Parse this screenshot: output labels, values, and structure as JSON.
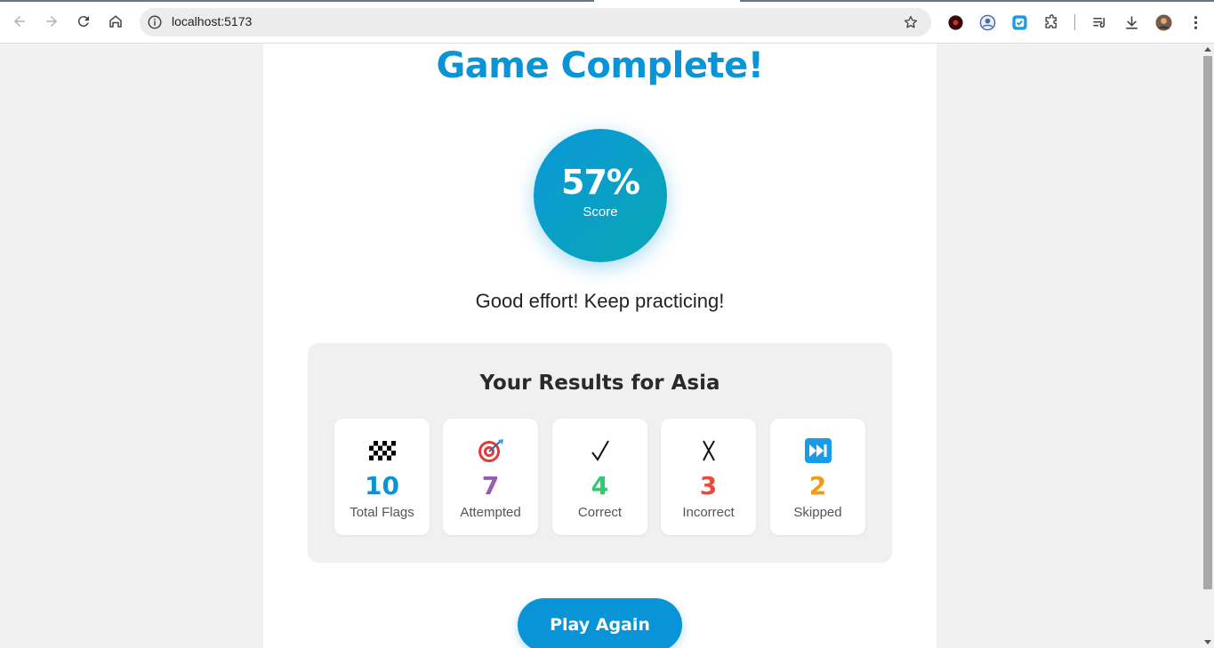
{
  "browser": {
    "url": "localhost:5173",
    "icons": [
      "back-icon",
      "forward-icon",
      "reload-icon",
      "home-icon",
      "site-info-icon",
      "bookmark-star-icon",
      "extension-record-icon",
      "extension-profile-icon",
      "extension-check-icon",
      "extensions-puzzle-icon",
      "reading-list-icon",
      "download-icon",
      "avatar",
      "menu-kebab-icon"
    ]
  },
  "game": {
    "title": "Game Complete!",
    "score": {
      "value": "57%",
      "label": "Score",
      "percent": 57
    },
    "message": "Good effort! Keep practicing!",
    "results_title": "Your Results for Asia",
    "stats": [
      {
        "icon": "checkered-flag-icon",
        "value": "10",
        "label": "Total Flags",
        "color": "#0a94d8"
      },
      {
        "icon": "target-icon",
        "value": "7",
        "label": "Attempted",
        "color": "#9b59b6"
      },
      {
        "icon": "checkmark-icon",
        "value": "4",
        "label": "Correct",
        "color": "#2ecc71"
      },
      {
        "icon": "cross-icon",
        "value": "3",
        "label": "Incorrect",
        "color": "#e74c3c"
      },
      {
        "icon": "fast-forward-icon",
        "value": "2",
        "label": "Skipped",
        "color": "#f39c12"
      }
    ],
    "play_again": "Play Again"
  },
  "colors": {
    "accent": "#0a94d8",
    "gradient_end": "#0aa7b4"
  }
}
